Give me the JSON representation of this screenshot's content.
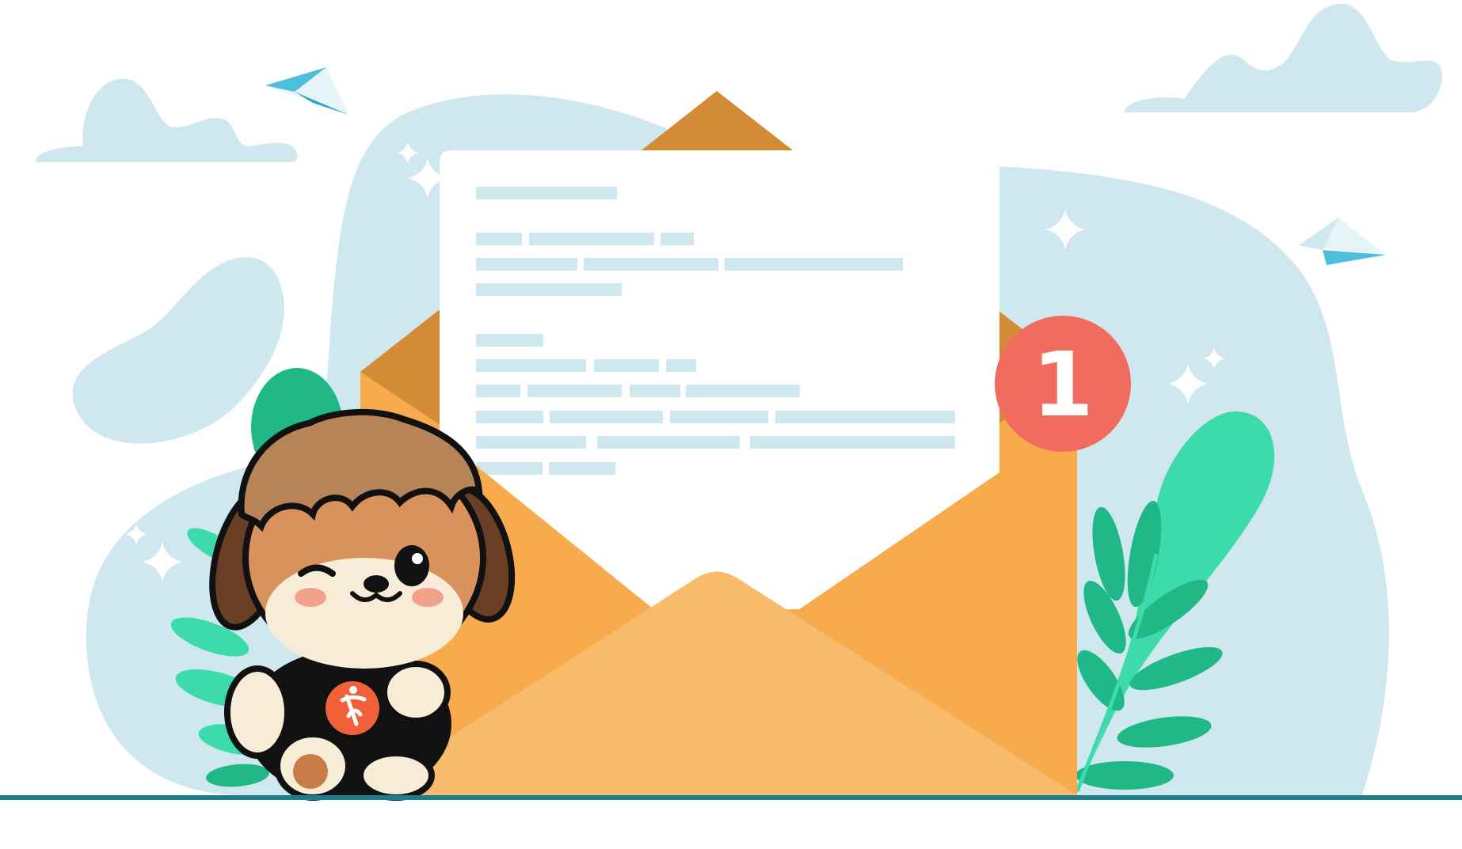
{
  "illustration": {
    "subject": "email-notification",
    "notification_badge": {
      "count": "1"
    },
    "mascot": {
      "icon": "mascot-logo-icon"
    },
    "icons": [
      "cloud-icon",
      "paper-plane-icon",
      "sparkle-icon",
      "leaf-icon",
      "envelope-icon",
      "letter-icon",
      "notification-badge-icon"
    ]
  },
  "colors": {
    "background": "#ffffff",
    "blob": "#cfe7ee",
    "cloud": "#cfe7ee",
    "envelope_back": "#d38b35",
    "envelope_body": "#f8ab4c",
    "envelope_front_flap": "#f8bb6b",
    "letter": "#ffffff",
    "letter_lines": "#cfe7ee",
    "badge": "#f26b5f",
    "badge_text": "#ffffff",
    "leaf_light": "#3ddbaa",
    "leaf_dark": "#21b887",
    "plane": "#4bbfdc",
    "ground_line": "#1a7d92",
    "mascot_fur": "#b88357",
    "mascot_shirt": "#111111",
    "mascot_logo": "#f26039"
  }
}
